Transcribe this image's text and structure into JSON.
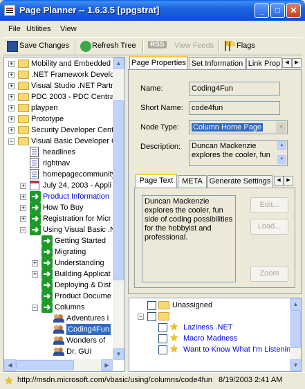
{
  "window": {
    "title": "Page Planner -- 1.6.3.5 [ppgstrat]",
    "controls": {
      "minimize": "_",
      "maximize": "□",
      "close": "✕"
    }
  },
  "menu": [
    "File",
    "Utilities",
    "View"
  ],
  "toolbar": {
    "save": "Save Changes",
    "refresh": "Refresh Tree",
    "rss": "RSS",
    "view_feeds": "View Feeds",
    "flags": "Flags"
  },
  "tree": {
    "items": [
      {
        "label": "Mobility and Embedded I",
        "icon": "folder-icon"
      },
      {
        "label": ".NET Framework Develc",
        "icon": "folder-icon"
      },
      {
        "label": "Visual Studio .NET Partn",
        "icon": "folder-icon"
      },
      {
        "label": "PDC 2003 - PDC Central",
        "icon": "folder-icon"
      },
      {
        "label": "playpen",
        "icon": "folder-icon"
      },
      {
        "label": "Prototype",
        "icon": "folder-icon"
      },
      {
        "label": "Security Developer Cent",
        "icon": "folder-icon"
      },
      {
        "label": "Visual Basic Developer C",
        "icon": "folder-icon"
      },
      {
        "label": "headlines",
        "icon": "document-icon"
      },
      {
        "label": "rightnav",
        "icon": "document-icon"
      },
      {
        "label": "homepagecommunity",
        "icon": "document-icon"
      },
      {
        "label": "July 24, 2003 - Appli",
        "icon": "calendar-icon"
      },
      {
        "label": "Product Information",
        "icon": "green-arrow-icon"
      },
      {
        "label": "How To Buy",
        "icon": "green-arrow-icon"
      },
      {
        "label": "Registration for Micr",
        "icon": "green-arrow-icon"
      },
      {
        "label": "Using Visual Basic .N",
        "icon": "green-arrow-icon"
      },
      {
        "label": "Getting Started",
        "icon": "green-arrow-icon"
      },
      {
        "label": "Migrating",
        "icon": "green-arrow-icon"
      },
      {
        "label": "Understanding",
        "icon": "green-arrow-icon"
      },
      {
        "label": "Building Applicat",
        "icon": "green-arrow-icon"
      },
      {
        "label": "Deploying & Dist",
        "icon": "green-arrow-icon"
      },
      {
        "label": "Product Docume",
        "icon": "green-arrow-icon"
      },
      {
        "label": "Columns",
        "icon": "green-arrow-icon"
      },
      {
        "label": "Adventures i",
        "icon": "people-icon"
      },
      {
        "label": "Coding4Fun",
        "icon": "people-icon"
      },
      {
        "label": "Wonders of",
        "icon": "people-icon"
      },
      {
        "label": "Dr. GUI",
        "icon": "people-icon"
      }
    ],
    "expander_plus": "+",
    "expander_minus": "−"
  },
  "top_tabs": [
    "Page Properties",
    "Set Information",
    "Link Prop"
  ],
  "properties": {
    "name_label": "Name:",
    "name_value": "Coding4Fun",
    "short_name_label": "Short Name:",
    "short_name_value": "code4fun",
    "node_type_label": "Node Type:",
    "node_type_value": "Column Home Page",
    "description_label": "Description:",
    "description_value": "Duncan Mackenzie explores the cooler, fun"
  },
  "inner_tabs": [
    "Page Text",
    "META",
    "Generate Settings"
  ],
  "page_text": {
    "body": "Duncan Mackenzie explores the cooler, fun side of coding possibilities for the hobbyist and professional.",
    "edit_button": "Edit...",
    "load_button": "Load...",
    "zoom_button": "Zoom"
  },
  "flags_tree": {
    "items": [
      {
        "label": "Unassigned",
        "icon": "folder-icon",
        "link": false
      },
      {
        "label": "",
        "icon": "folder-icon",
        "link": false
      },
      {
        "label": "Laziness .NET",
        "icon": "star-icon",
        "link": true
      },
      {
        "label": "Macro Madness",
        "icon": "star-icon",
        "link": true
      },
      {
        "label": "Want to Know What I'm Listenin",
        "icon": "star-icon",
        "link": true
      }
    ]
  },
  "status": {
    "url": "http://msdn.microsoft.com/vbasic/using/columns/code4fun",
    "timestamp": "8/19/2003 2:41 AM"
  },
  "colors": {
    "title_bar": "#0A4FD0",
    "selection": "#316AC5",
    "link": "#0000EE",
    "green_arrow": "#1F9A2A",
    "window_bg": "#ECE9D8"
  }
}
